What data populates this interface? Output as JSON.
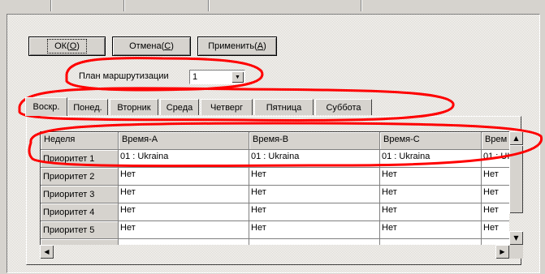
{
  "buttons": {
    "ok": {
      "text": "ОК(",
      "key": "O",
      "end": ")"
    },
    "cancel": {
      "text": "Отмена(",
      "key": "C",
      "end": ")"
    },
    "apply": {
      "text": "Применить(",
      "key": "A",
      "end": ")"
    }
  },
  "routing": {
    "label": "План маршрутизации",
    "value": "1"
  },
  "tabs": [
    "Воскр.",
    "Понед.",
    "Вторник",
    "Среда",
    "Четверг",
    "Пятница",
    "Суббота"
  ],
  "active_tab": "Воскр.",
  "grid": {
    "headers": [
      "Неделя",
      "Время-А",
      "Время-В",
      "Время-С",
      "Врем"
    ],
    "rows": [
      [
        "Приоритет 1",
        "01 : Ukraina",
        "01 : Ukraina",
        "01 : Ukraina",
        "01 : UI"
      ],
      [
        "Приоритет 2",
        "Нет",
        "Нет",
        "Нет",
        "Нет"
      ],
      [
        "Приоритет 3",
        "Нет",
        "Нет",
        "Нет",
        "Нет"
      ],
      [
        "Приоритет 4",
        "Нет",
        "Нет",
        "Нет",
        "Нет"
      ],
      [
        "Приоритет 5",
        "Нет",
        "Нет",
        "Нет",
        "Нет"
      ],
      [
        "",
        "",
        "",
        "",
        ""
      ]
    ]
  },
  "icons": {
    "dropdown": "chevron-down-icon",
    "scroll_up": "arrow-up-icon",
    "scroll_down": "arrow-down-icon",
    "scroll_left": "arrow-left-icon",
    "scroll_right": "arrow-right-icon"
  },
  "colors": {
    "annotation": "#ff0000",
    "face": "#d6d3ce"
  }
}
